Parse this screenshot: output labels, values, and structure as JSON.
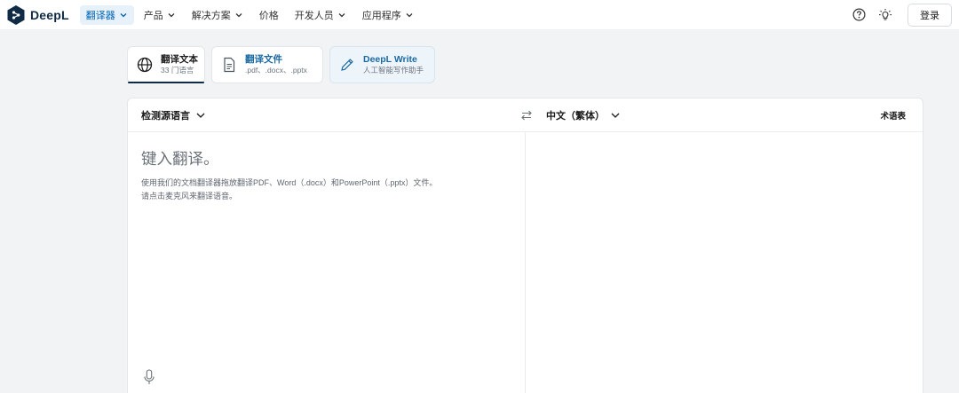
{
  "app": {
    "name": "DeepL"
  },
  "nav": {
    "items": [
      {
        "label": "翻译器",
        "active": true
      },
      {
        "label": "产品"
      },
      {
        "label": "解决方案"
      },
      {
        "label": "价格"
      },
      {
        "label": "开发人员"
      },
      {
        "label": "应用程序"
      }
    ],
    "login_label": "登录",
    "icons": [
      "help-icon",
      "theme-bulb-icon"
    ]
  },
  "modes": [
    {
      "title": "翻译文本",
      "subtitle": "33 门语言",
      "icon": "globe-icon",
      "selected": true
    },
    {
      "title": "翻译文件",
      "subtitle": ".pdf、.docx、.pptx",
      "icon": "document-icon"
    },
    {
      "title": "DeepL Write",
      "subtitle": "人工智能写作助手",
      "icon": "pen-icon"
    }
  ],
  "translator": {
    "source_language": "检测源语言",
    "target_language": "中文（繁体）",
    "glossary_label": "术语表",
    "input_placeholder": "键入翻译。",
    "hint_line1": "使用我们的文档翻译器拖放翻译PDF、Word（.docx）和PowerPoint（.pptx）文件。",
    "hint_line2": "请点击麦克风来翻译语音。"
  },
  "colors": {
    "brand_dark": "#0f2b46",
    "accent_blue": "#0063b1",
    "page_bg": "#f1f3f5"
  }
}
